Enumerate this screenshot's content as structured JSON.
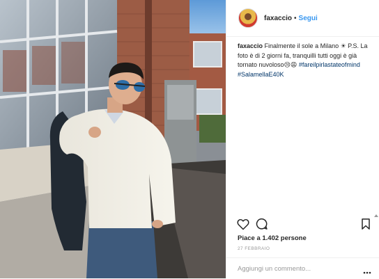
{
  "post": {
    "username": "faxaccio",
    "separator": "•",
    "follow_label": "Segui"
  },
  "caption": {
    "username": "faxaccio",
    "text": " Finalmente il sole a Milano ☀ P.S. La foto è di 2 giorni fa, tranquilli tutti oggi è già tornato nuvoloso😢😩 ",
    "hashtag_1": "#fareilpirlastateofmind",
    "hashtag_2": "#SalamellaE40K"
  },
  "stats": {
    "likes_text": "Piace a 1.402 persone",
    "date": "27 febbraio"
  },
  "comment": {
    "placeholder": "Aggiungi un commento..."
  },
  "icons": {
    "like": "heart-icon",
    "comment": "comment-bubble-icon",
    "save": "bookmark-icon",
    "more": "more-options-icon"
  },
  "colors": {
    "link": "#3897f0",
    "hashtag": "#003569",
    "text": "#262626",
    "muted": "#999999"
  }
}
